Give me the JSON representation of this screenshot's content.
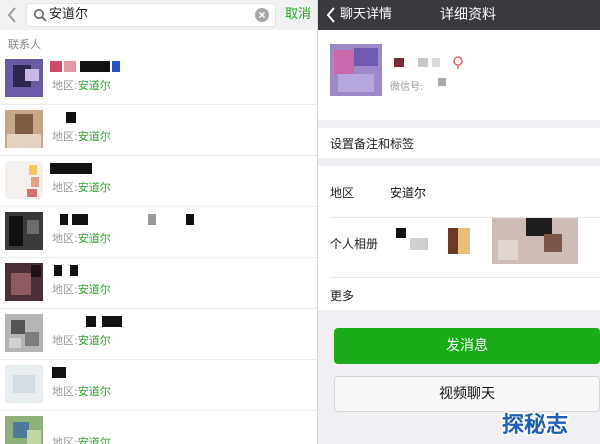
{
  "search": {
    "query": "安道尔",
    "cancel": "取消",
    "section_label": "联系人"
  },
  "contacts": [
    {
      "region_label": "地区:",
      "region_value": "安道尔"
    },
    {
      "region_label": "地区:",
      "region_value": "安道尔"
    },
    {
      "region_label": "地区:",
      "region_value": "安道尔"
    },
    {
      "region_label": "地区:",
      "region_value": "安道尔"
    },
    {
      "region_label": "地区:",
      "region_value": "安道尔"
    },
    {
      "region_label": "地区:",
      "region_value": "安道尔"
    },
    {
      "region_label": "地区:",
      "region_value": "安道尔"
    },
    {
      "region_label": "地区:",
      "region_value": "安道尔"
    }
  ],
  "detail": {
    "back_label": "聊天详情",
    "title": "详细资料",
    "wechat_id_label": "微信号:",
    "remark_label": "设置备注和标签",
    "region_label": "地区",
    "region_value": "安道尔",
    "album_label": "个人相册",
    "more_label": "更多",
    "send_message": "发消息",
    "video_call": "视频聊天"
  },
  "watermark": "探秘志",
  "colors": {
    "accent_green": "#1aad19",
    "nav_dark": "#393a3f",
    "watermark_blue": "#1d5fb8"
  },
  "icons": [
    "back-icon",
    "search-icon",
    "clear-icon",
    "gender-icon"
  ]
}
